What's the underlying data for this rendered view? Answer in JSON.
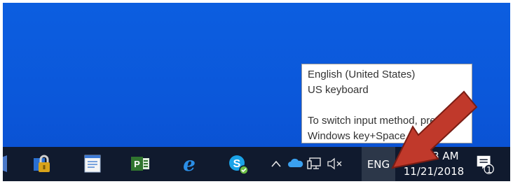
{
  "tooltip": {
    "line1": "English (United States)",
    "line2": "US keyboard",
    "line3": "To switch input method, press",
    "line4": "Windows key+Space"
  },
  "taskbar": {
    "language": "ENG",
    "time": "11:33 AM",
    "date": "11/21/2018",
    "notification_count": "1",
    "apps": [
      "app-icon",
      "lock-app-icon",
      "notepad-icon",
      "project-icon",
      "edge-icon",
      "skype-icon"
    ],
    "tray": [
      "chevron-up-icon",
      "onedrive-cloud-icon",
      "network-icon",
      "volume-muted-icon"
    ]
  },
  "colors": {
    "desktop": "#0b57da",
    "taskbar": "#101a2e",
    "arrow": "#c0392b"
  }
}
